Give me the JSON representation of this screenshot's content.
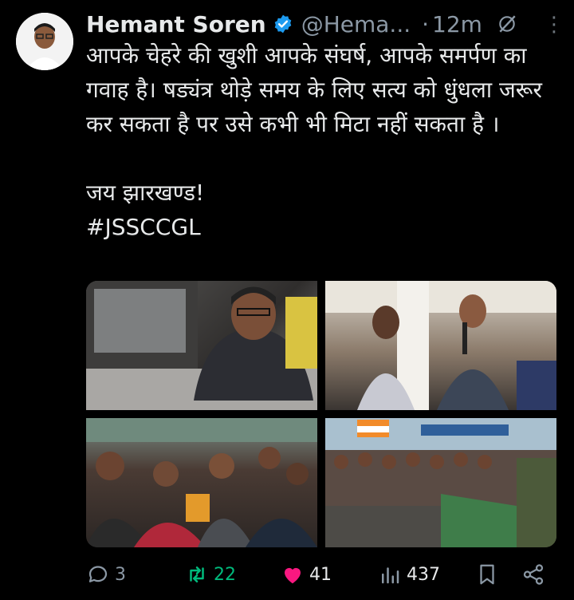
{
  "tweet": {
    "author_name": "Hemant Soren",
    "handle": "@Hema...",
    "time_separator": "·",
    "time": "12m",
    "text": "आपके चेहरे की खुशी आपके संघर्ष, आपके समर्पण का गवाह है। षड्यंत्र थोड़े समय के लिए सत्य को धुंधला जरूर कर सकता है पर उसे कभी भी मिटा नहीं सकता है ।\n\nजय झारखण्ड!\n#JSSCCGL"
  },
  "actions": {
    "replies": "3",
    "retweets": "22",
    "likes": "41",
    "views": "437"
  },
  "colors": {
    "background": "#000000",
    "text": "#e7e9ea",
    "secondary": "#8b98a5",
    "verified": "#1d9bf0",
    "retweet": "#00ba7c",
    "like": "#f91880"
  },
  "icons": [
    "verified-badge-icon",
    "grok-icon",
    "more-icon",
    "reply-icon",
    "retweet-icon",
    "like-icon",
    "views-icon",
    "bookmark-icon",
    "share-icon"
  ]
}
